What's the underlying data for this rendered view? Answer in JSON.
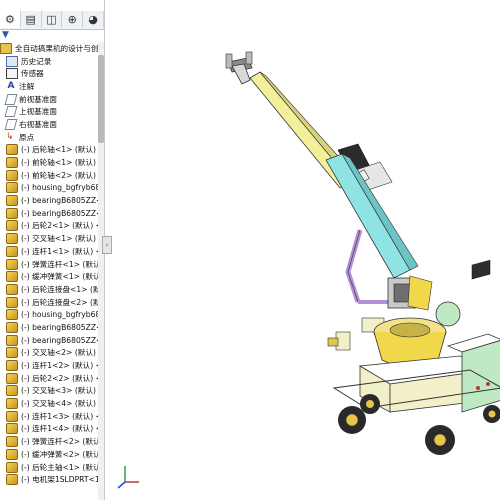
{
  "panel": {
    "tabs": [
      {
        "name": "feature-tree-tab-icon",
        "glyph": "⚙"
      },
      {
        "name": "property-tab-icon",
        "glyph": "▤"
      },
      {
        "name": "config-tab-icon",
        "glyph": "◫"
      },
      {
        "name": "dimxpert-tab-icon",
        "glyph": "⊕"
      },
      {
        "name": "display-tab-icon",
        "glyph": "◕"
      }
    ],
    "filter_glyph": "▼"
  },
  "tree": {
    "root": "全自动搞果机的设计与创新",
    "items": [
      {
        "icon": "hist",
        "label": "历史记录"
      },
      {
        "icon": "sensor",
        "label": "传感器"
      },
      {
        "icon": "note",
        "label": "注解"
      },
      {
        "icon": "plane",
        "label": "前视基准面"
      },
      {
        "icon": "plane",
        "label": "上视基准面"
      },
      {
        "icon": "plane",
        "label": "右视基准面"
      },
      {
        "icon": "origin",
        "label": "原点"
      },
      {
        "icon": "part",
        "label": "(-) 后轮轴<1> (默认) <"
      },
      {
        "icon": "part",
        "label": "(-) 前轮轴<1> (默认) <"
      },
      {
        "icon": "part",
        "label": "(-) 前轮轴<2> (默认) <"
      },
      {
        "icon": "part",
        "label": "(-) housing_bgfryb680"
      },
      {
        "icon": "part",
        "label": "(-) bearingB6805ZZ<1"
      },
      {
        "icon": "part",
        "label": "(-) bearingB6805ZZ<2"
      },
      {
        "icon": "part",
        "label": "(-) 后轮2<1> (默认) <<"
      },
      {
        "icon": "part",
        "label": "(-) 交叉轴<1> (默认) <<"
      },
      {
        "icon": "part",
        "label": "(-) 连杆1<1> (默认) <<"
      },
      {
        "icon": "part",
        "label": "(-) 弹簧连杆<1> (默认)"
      },
      {
        "icon": "part",
        "label": "(-) 缓冲弹簧<1> (默认)"
      },
      {
        "icon": "part",
        "label": "(-) 后轮连接盘<1> (默认"
      },
      {
        "icon": "part",
        "label": "(-) 后轮连接盘<2> (默认"
      },
      {
        "icon": "part",
        "label": "(-) housing_bgfryb680"
      },
      {
        "icon": "part",
        "label": "(-) bearingB6805ZZ<3"
      },
      {
        "icon": "part",
        "label": "(-) bearingB6805ZZ<4"
      },
      {
        "icon": "part",
        "label": "(-) 交叉轴<2> (默认) <<"
      },
      {
        "icon": "part",
        "label": "(-) 连杆1<2> (默认) <<"
      },
      {
        "icon": "part",
        "label": "(-) 后轮2<2> (默认) <<"
      },
      {
        "icon": "part",
        "label": "(-) 交叉轴<3> (默认) <<"
      },
      {
        "icon": "part",
        "label": "(-) 交叉轴<4> (默认) <<"
      },
      {
        "icon": "part",
        "label": "(-) 连杆1<3> (默认) <<"
      },
      {
        "icon": "part",
        "label": "(-) 连杆1<4> (默认) <<"
      },
      {
        "icon": "part",
        "label": "(-) 弹簧连杆<2> (默认)"
      },
      {
        "icon": "part",
        "label": "(-) 缓冲弹簧<2> (默认)"
      },
      {
        "icon": "part",
        "label": "(-) 后轮主轴<1> (默认) <"
      },
      {
        "icon": "part",
        "label": "(-) 电机架1SLDPRT<1>"
      }
    ]
  },
  "colors": {
    "arm_yellow": "#f4ef9a",
    "arm_cyan": "#8fe3e3",
    "link_purple": "#b48fd8",
    "body_cream": "#f2f0c8",
    "panel_green": "#bfe9c2",
    "wheel_dark": "#2a2a2a",
    "wheel_yellow": "#e8c64a",
    "accent_yellow": "#f0d84a"
  }
}
